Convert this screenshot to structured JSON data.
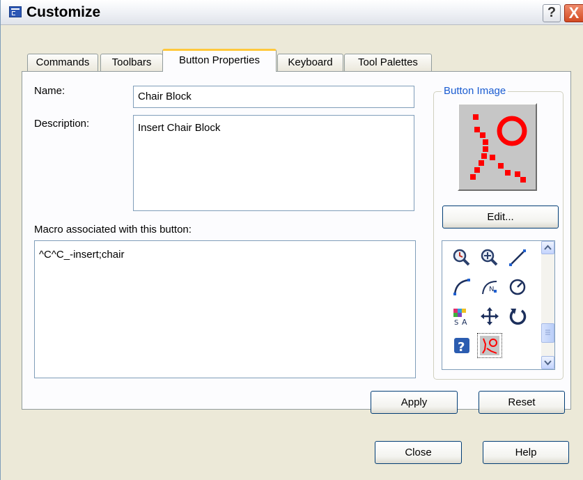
{
  "window": {
    "title": "Customize",
    "help_glyph": "?",
    "close_glyph": "X"
  },
  "tabs": [
    {
      "label": "Commands"
    },
    {
      "label": "Toolbars"
    },
    {
      "label": "Button Properties",
      "active": true
    },
    {
      "label": "Keyboard"
    },
    {
      "label": "Tool Palettes"
    }
  ],
  "form": {
    "name_label": "Name:",
    "name_value": "Chair Block",
    "description_label": "Description:",
    "description_value": "Insert Chair Block",
    "macro_label": "Macro associated with this button:",
    "macro_value": "^C^C_-insert;chair"
  },
  "button_image": {
    "group_title": "Button Image",
    "edit_label": "Edit...",
    "icons": [
      {
        "name": "zoom-realtime-icon"
      },
      {
        "name": "zoom-in-icon"
      },
      {
        "name": "line-icon"
      },
      {
        "name": "arc-icon"
      },
      {
        "name": "arc-named-icon"
      },
      {
        "name": "dial-icon"
      },
      {
        "name": "style-text-icon"
      },
      {
        "name": "move-icon"
      },
      {
        "name": "rotate-icon"
      },
      {
        "name": "help-icon"
      },
      {
        "name": "chair-block-icon",
        "selected": true
      }
    ]
  },
  "actions": {
    "apply_label": "Apply",
    "reset_label": "Reset"
  },
  "footer": {
    "close_label": "Close",
    "help_label": "Help"
  },
  "colors": {
    "accent": "#1a5cd1",
    "tab_highlight": "#ffc83c",
    "chair_icon": "#ff0000",
    "preview_bg": "#c6c6c6"
  }
}
